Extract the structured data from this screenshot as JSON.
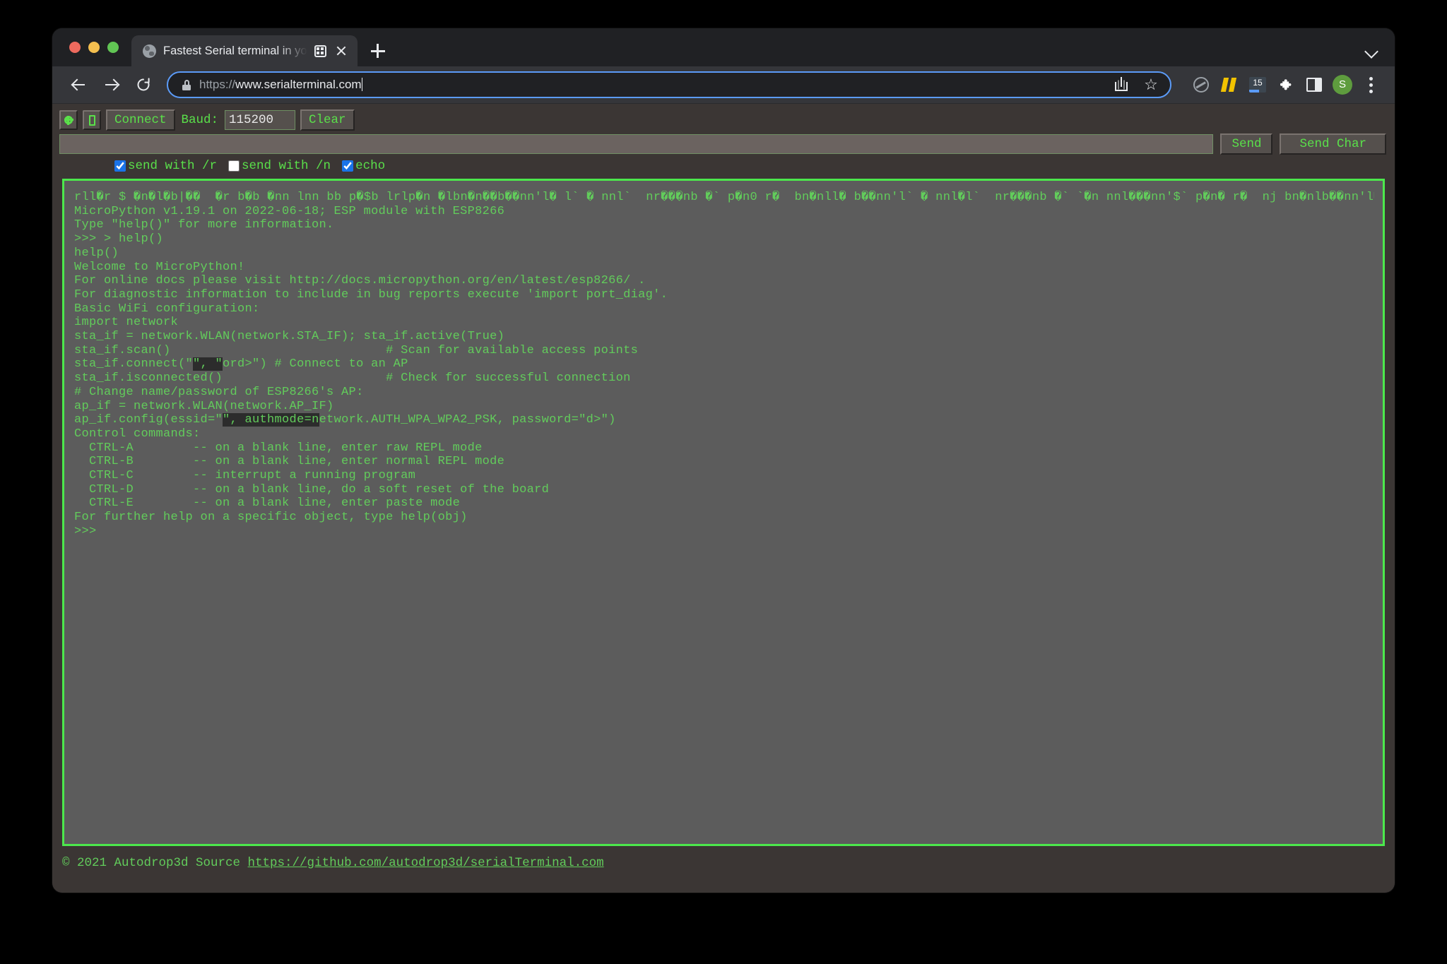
{
  "browser": {
    "traffic_lights": [
      "close",
      "minimize",
      "zoom"
    ],
    "tab": {
      "title": "Fastest Serial terminal in yo",
      "favicon": "globe-icon",
      "media_icon": "media-control-icon",
      "close_icon": "close-icon"
    },
    "new_tab_label": "+",
    "toolbar": {
      "back_icon": "back-arrow-icon",
      "forward_icon": "forward-arrow-icon",
      "reload_icon": "reload-icon",
      "lock_icon": "lock-icon",
      "url_scheme": "https://",
      "url_host": "www.serialterminal.com",
      "share_icon": "share-icon",
      "star_icon": "☆",
      "extensions": [
        {
          "name": "circle-slash-icon",
          "label": ""
        },
        {
          "name": "bars-icon",
          "label": ""
        },
        {
          "name": "counter-icon",
          "label": "15"
        },
        {
          "name": "puzzle-icon",
          "label": ""
        },
        {
          "name": "side-panel-icon",
          "label": ""
        },
        {
          "name": "profile-avatar",
          "label": "S"
        },
        {
          "name": "kebab-menu-icon",
          "label": ""
        }
      ]
    }
  },
  "app": {
    "controls": {
      "settings_icon": "gear-icon",
      "device_icon": "board-icon",
      "connect_label": "Connect",
      "baud_label": "Baud:",
      "baud_value": "115200",
      "clear_label": "Clear"
    },
    "send": {
      "input_value": "",
      "input_placeholder": "",
      "send_label": "Send",
      "send_char_label": "Send Char"
    },
    "options": [
      {
        "label": "send with /r",
        "checked": true
      },
      {
        "label": "send with /n",
        "checked": false
      },
      {
        "label": "echo",
        "checked": true
      }
    ],
    "terminal": {
      "border_color": "#4ce84c",
      "background_color": "#5c5c5c",
      "text_color": "#62cc5b",
      "lines": [
        "rll�r $ �n�l�b|��  �r b�b �nn lnn bb p�$b lrlp�n �lbn�n��b��nn'l� l` � nnl`  nr���nb �` p�n0 r�  bn�nll� b��nn'l` � nnl�l`  nr���nb �` `�n nnl���nn'$` p�n� r�  nj bn�nlb��nn'l�l` � nnl�l`  nr���",
        "MicroPython v1.19.1 on 2022-06-18; ESP module with ESP8266",
        "Type \"help()\" for more information.",
        ">>> > help()",
        "help()",
        "Welcome to MicroPython!",
        "",
        "",
        "For online docs please visit http://docs.micropython.org/en/latest/esp8266/ .",
        "For diagnostic information to include in bug reports execute 'import port_diag'.",
        "",
        "Basic WiFi configuration:",
        "",
        "",
        "import network",
        "sta_if = network.WLAN(network.STA_IF); sta_if.active(True)",
        "sta_if.scan()                             # Scan for available access points",
        "sta_if.isconnected()                      # Check for successful connection",
        "# Change name/password of ESP8266's AP:",
        "ap_if = network.WLAN(network.AP_IF)",
        "",
        "Control commands:",
        "  CTRL-A        -- on a blank line, enter raw REPL mode",
        "  CTRL-B        -- on a blank line, enter normal REPL mode",
        "  CTRL-C        -- interrupt a running program",
        "  CTRL-D        -- on a blank line, do a soft reset of the board",
        "  CTRL-E        -- on a blank line, enter paste mode",
        "",
        "For further help on a specific object, type help(obj)",
        ">>>"
      ],
      "connect_line": {
        "prefix": "sta_if.connect(\"",
        "highlight": "\", \"",
        "suffix": "ord>\") # Connect to an AP"
      },
      "config_line": {
        "prefix": "ap_if.config(essid=\"",
        "highlight": "\", authmode=n",
        "suffix": "etwork.AUTH_WPA_WPA2_PSK, password=\"d>\")"
      }
    },
    "footer": {
      "copyright": "© 2021 Autodrop3d Source ",
      "link": "https://github.com/autodrop3d/serialTerminal.com"
    }
  }
}
